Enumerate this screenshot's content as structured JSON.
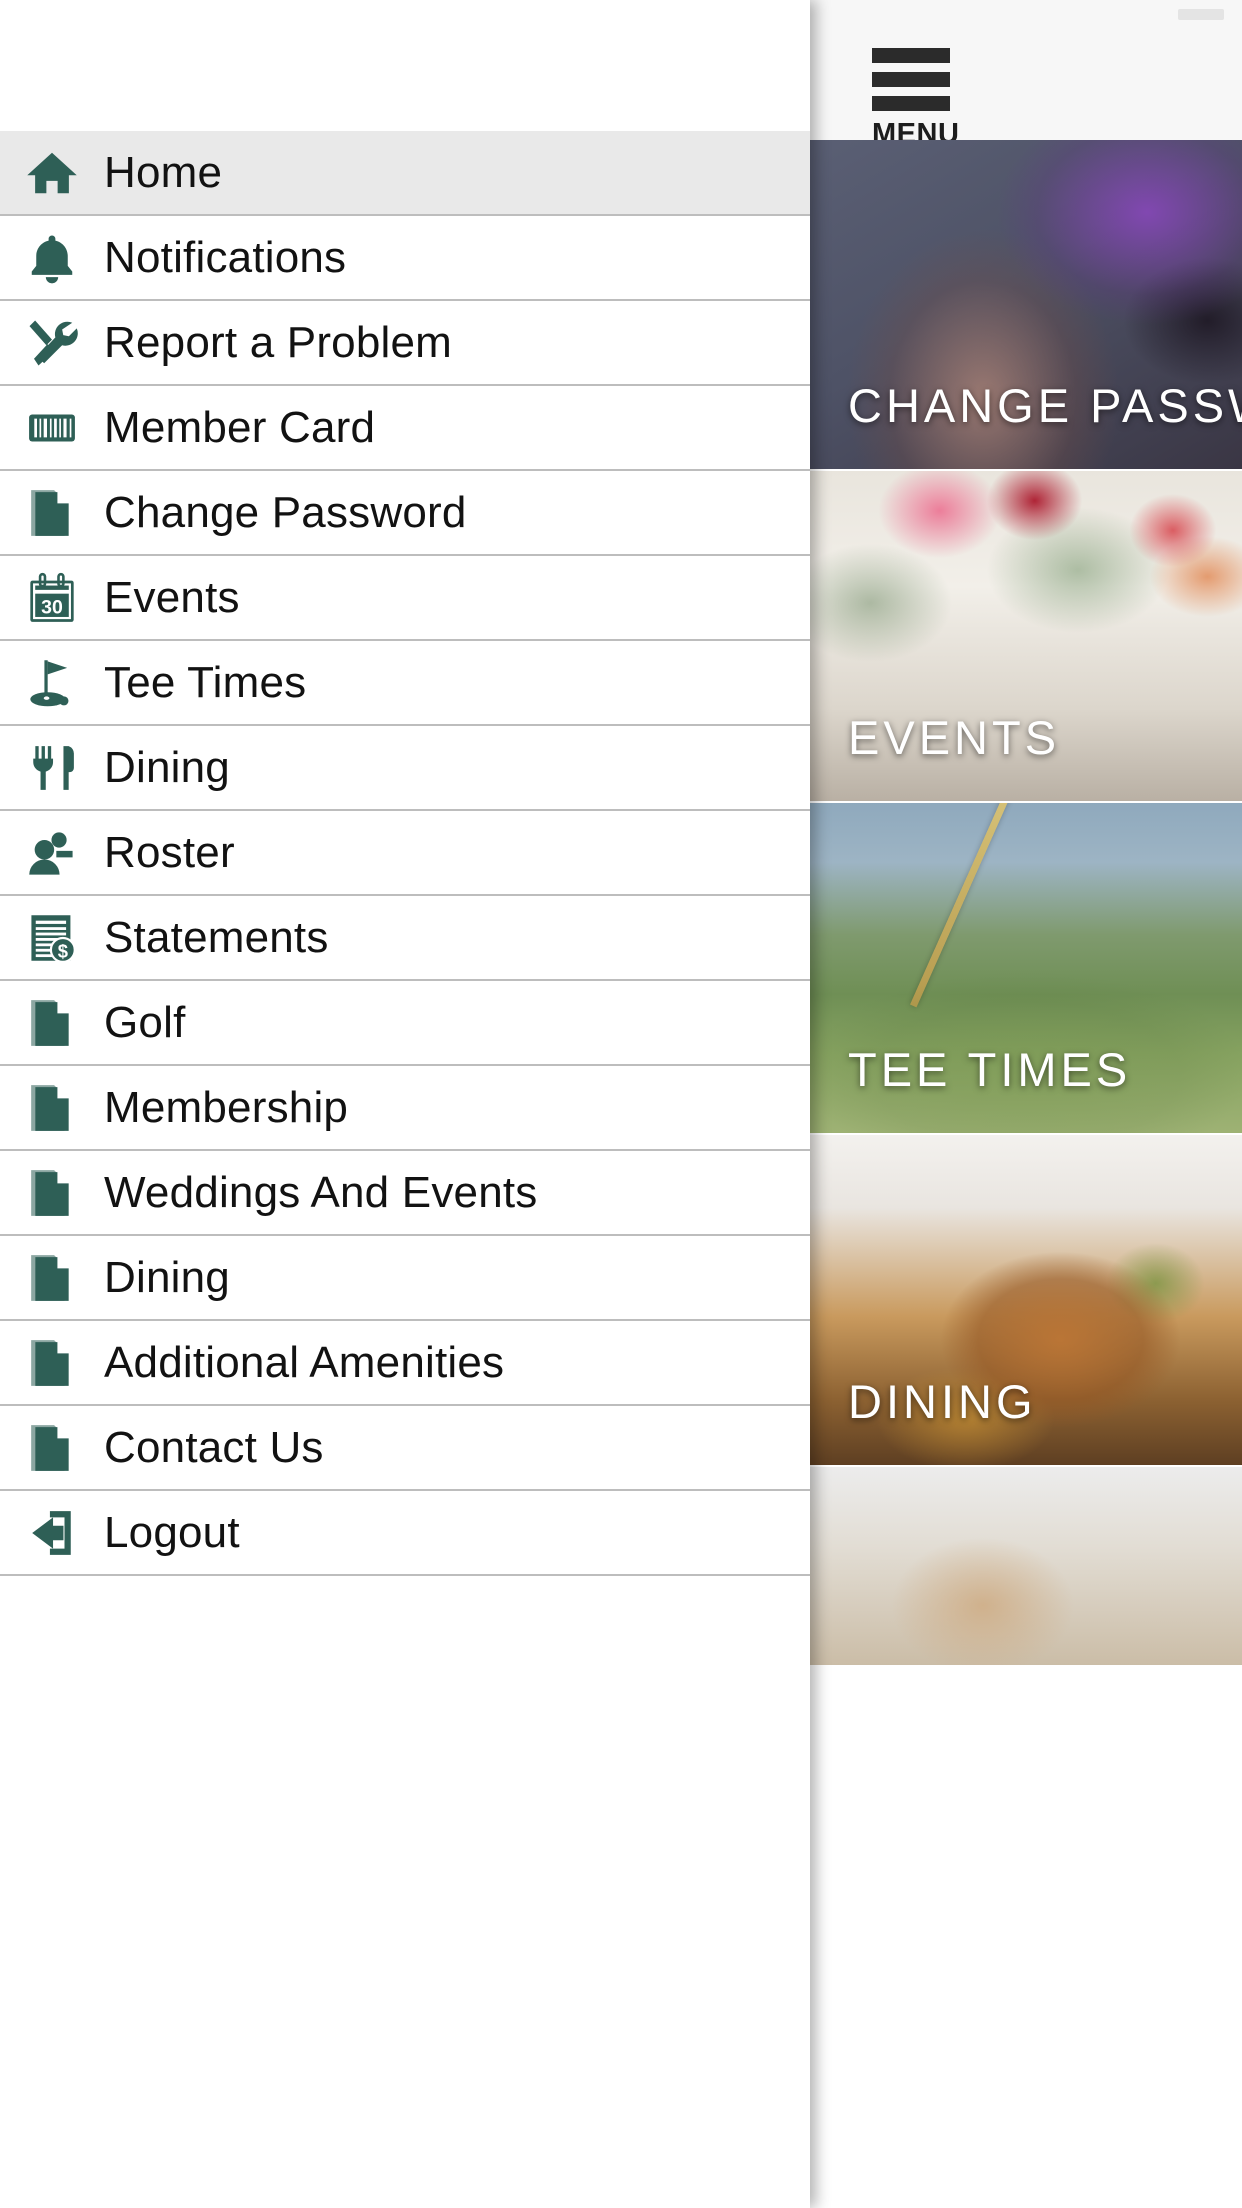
{
  "app": {
    "accent_green": "#2e5f56",
    "selected_row_bg": "#e9e9e9",
    "divider_color": "#bdbdbd",
    "text_color": "#121212"
  },
  "header": {
    "menu_label": "MENU",
    "menu_icon": "hamburger-icon"
  },
  "drawer": {
    "items": [
      {
        "label": "Home",
        "icon": "home-icon",
        "selected": true
      },
      {
        "label": "Notifications",
        "icon": "bell-icon",
        "selected": false
      },
      {
        "label": "Report a Problem",
        "icon": "tools-icon",
        "selected": false
      },
      {
        "label": "Member Card",
        "icon": "barcode-icon",
        "selected": false
      },
      {
        "label": "Change Password",
        "icon": "document-icon",
        "selected": false
      },
      {
        "label": "Events",
        "icon": "calendar-30-icon",
        "selected": false
      },
      {
        "label": "Tee Times",
        "icon": "golf-flag-icon",
        "selected": false
      },
      {
        "label": "Dining",
        "icon": "cutlery-icon",
        "selected": false
      },
      {
        "label": "Roster",
        "icon": "people-icon",
        "selected": false
      },
      {
        "label": "Statements",
        "icon": "invoice-dollar-icon",
        "selected": false
      },
      {
        "label": "Golf",
        "icon": "document-icon",
        "selected": false
      },
      {
        "label": "Membership",
        "icon": "document-icon",
        "selected": false
      },
      {
        "label": "Weddings And Events",
        "icon": "document-icon",
        "selected": false
      },
      {
        "label": "Dining",
        "icon": "document-icon",
        "selected": false
      },
      {
        "label": "Additional Amenities",
        "icon": "document-icon",
        "selected": false
      },
      {
        "label": "Contact Us",
        "icon": "document-icon",
        "selected": false
      },
      {
        "label": "Logout",
        "icon": "logout-icon",
        "selected": false
      }
    ]
  },
  "main": {
    "cards": [
      {
        "title": "CHANGE PASSWORD"
      },
      {
        "title": "EVENTS"
      },
      {
        "title": "TEE TIMES"
      },
      {
        "title": "DINING"
      }
    ]
  }
}
